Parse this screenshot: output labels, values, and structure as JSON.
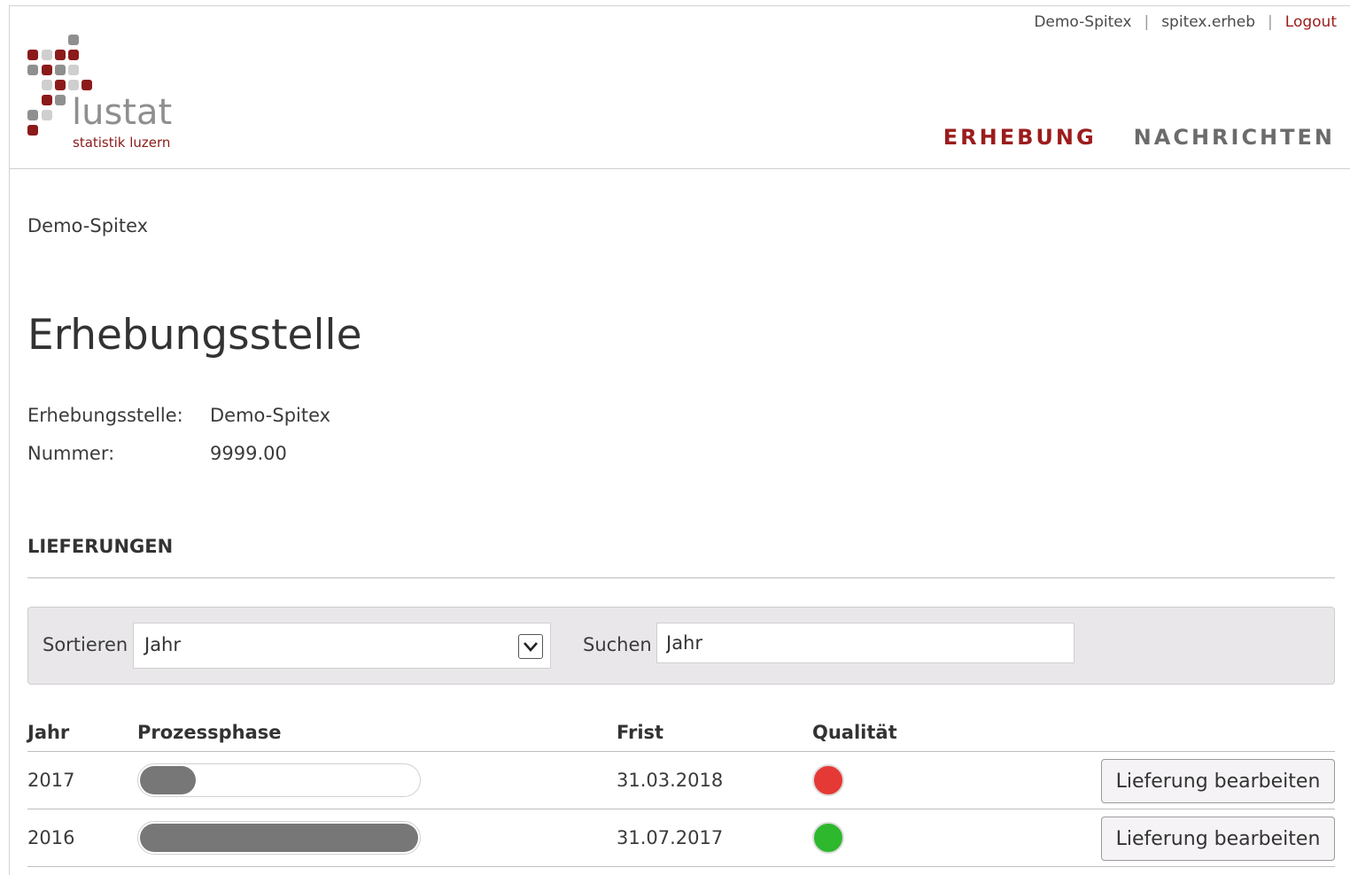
{
  "topnav": {
    "org": "Demo-Spitex",
    "user": "spitex.erheb",
    "logout": "Logout",
    "separator": "|"
  },
  "logo": {
    "name": "lustat",
    "tagline": "statistik luzern"
  },
  "mainnav": {
    "active": "ERHEBUNG",
    "inactive": "NACHRICHTEN"
  },
  "breadcrumb": "Demo-Spitex",
  "page_title": "Erhebungsstelle",
  "info": {
    "stelle_label": "Erhebungsstelle:",
    "stelle_value": "Demo-Spitex",
    "nummer_label": "Nummer:",
    "nummer_value": "9999.00"
  },
  "section_title": "LIEFERUNGEN",
  "filter": {
    "sort_label": "Sortieren",
    "sort_value": "Jahr",
    "search_label": "Suchen",
    "search_value": "Jahr"
  },
  "table": {
    "headers": {
      "jahr": "Jahr",
      "phase": "Prozessphase",
      "frist": "Frist",
      "qualitaet": "Qualität"
    },
    "rows": [
      {
        "jahr": "2017",
        "progress": 0.2,
        "frist": "31.03.2018",
        "quality_color": "#e53935",
        "action": "Lieferung bearbeiten"
      },
      {
        "jahr": "2016",
        "progress": 1.0,
        "frist": "31.07.2017",
        "quality_color": "#2eb82e",
        "action": "Lieferung bearbeiten"
      }
    ]
  },
  "colors": {
    "accent": "#9b1c1c",
    "progress": "#777777"
  }
}
